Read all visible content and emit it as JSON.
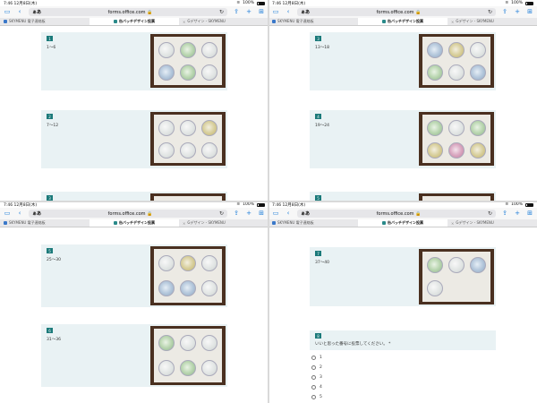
{
  "browser": {
    "time": "7:46",
    "date": "12月8日(木)",
    "battery": "100%",
    "address_label": "ぁあ",
    "host": "forms.office.com",
    "lock": "🔒"
  },
  "tabs": [
    {
      "label": "SKYMENU 電子連絡板"
    },
    {
      "label": "缶バッチデザイン投票"
    },
    {
      "label": "Gデザイン - SKYMENU"
    }
  ],
  "panes": {
    "tl": {
      "cards": [
        {
          "num": "1",
          "text": "1〜6"
        },
        {
          "num": "2",
          "text": "7〜12"
        },
        {
          "num": "3",
          "text": ""
        }
      ]
    },
    "tr": {
      "cards": [
        {
          "num": "3",
          "text": "13〜18"
        },
        {
          "num": "4",
          "text": "19〜24"
        },
        {
          "num": "5",
          "text": ""
        }
      ]
    },
    "bl": {
      "cards": [
        {
          "num": "5",
          "text": "25〜30"
        },
        {
          "num": "6",
          "text": "31〜36"
        }
      ]
    },
    "br": {
      "cards": [
        {
          "num": "7",
          "text": "37〜40"
        }
      ],
      "question": {
        "num": "8",
        "text": "いいと思った番号に投票してください。 *"
      },
      "options": [
        "1",
        "2",
        "3",
        "4",
        "5"
      ]
    }
  }
}
